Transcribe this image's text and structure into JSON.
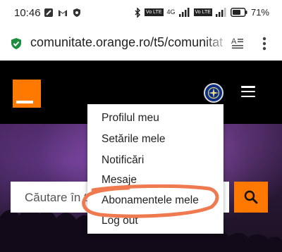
{
  "status_bar": {
    "time": "10:46",
    "battery_percent": "71",
    "battery_label": "71%",
    "network": "4G",
    "volte_a": "Vo LTE",
    "volte_b": "Vo LTE"
  },
  "browser": {
    "url": "comunitate.orange.ro/t5/comunitat"
  },
  "site": {
    "brand_color": "#ff7900",
    "search_placeholder": "Căutare în to"
  },
  "user_menu": {
    "items": [
      {
        "label": "Profilul meu"
      },
      {
        "label": "Setările mele"
      },
      {
        "label": "Notificări"
      },
      {
        "label": "Mesaje"
      },
      {
        "label": "Abonamentele mele"
      },
      {
        "label": "Log out"
      }
    ]
  },
  "annotation": {
    "highlight_color": "#f07a4f",
    "highlighted_item": "Abonamentele mele"
  }
}
